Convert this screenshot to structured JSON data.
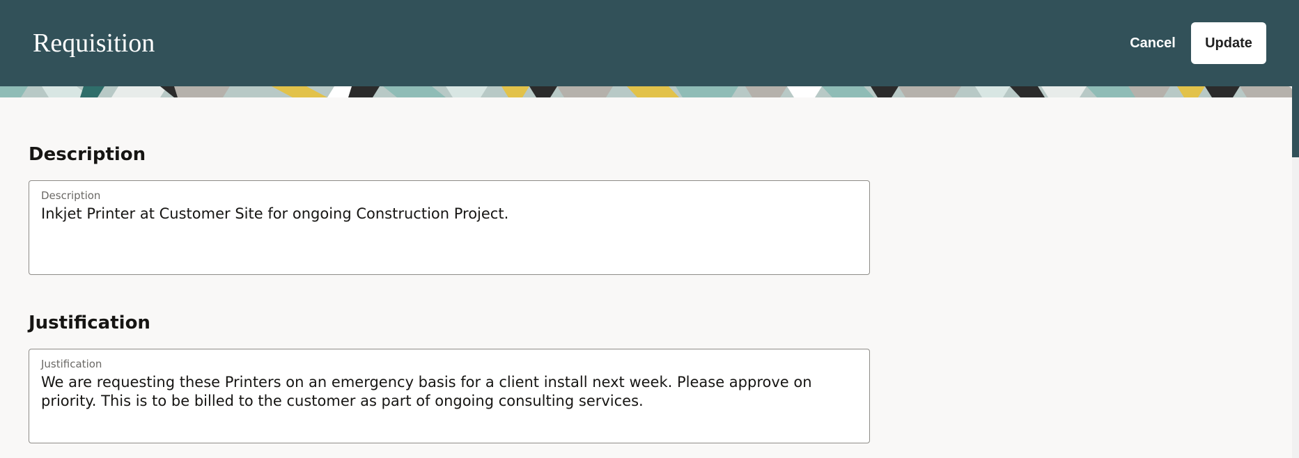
{
  "header": {
    "title": "Requisition",
    "cancel_label": "Cancel",
    "update_label": "Update",
    "background_color": "#325159"
  },
  "banner": {
    "description": "decorative-pattern",
    "colors": [
      "#8fbcb6",
      "#d8e6e3",
      "#2b2b2b",
      "#e2c24a",
      "#b5b1ab"
    ]
  },
  "sections": {
    "description": {
      "heading": "Description",
      "field_label": "Description",
      "field_value": "Inkjet Printer at Customer Site for ongoing Construction Project."
    },
    "justification": {
      "heading": "Justification",
      "field_label": "Justification",
      "field_value": "We are requesting these Printers on an emergency basis for a client install next week. Please approve on priority. This is to be billed to the customer as part of ongoing consulting services."
    }
  }
}
